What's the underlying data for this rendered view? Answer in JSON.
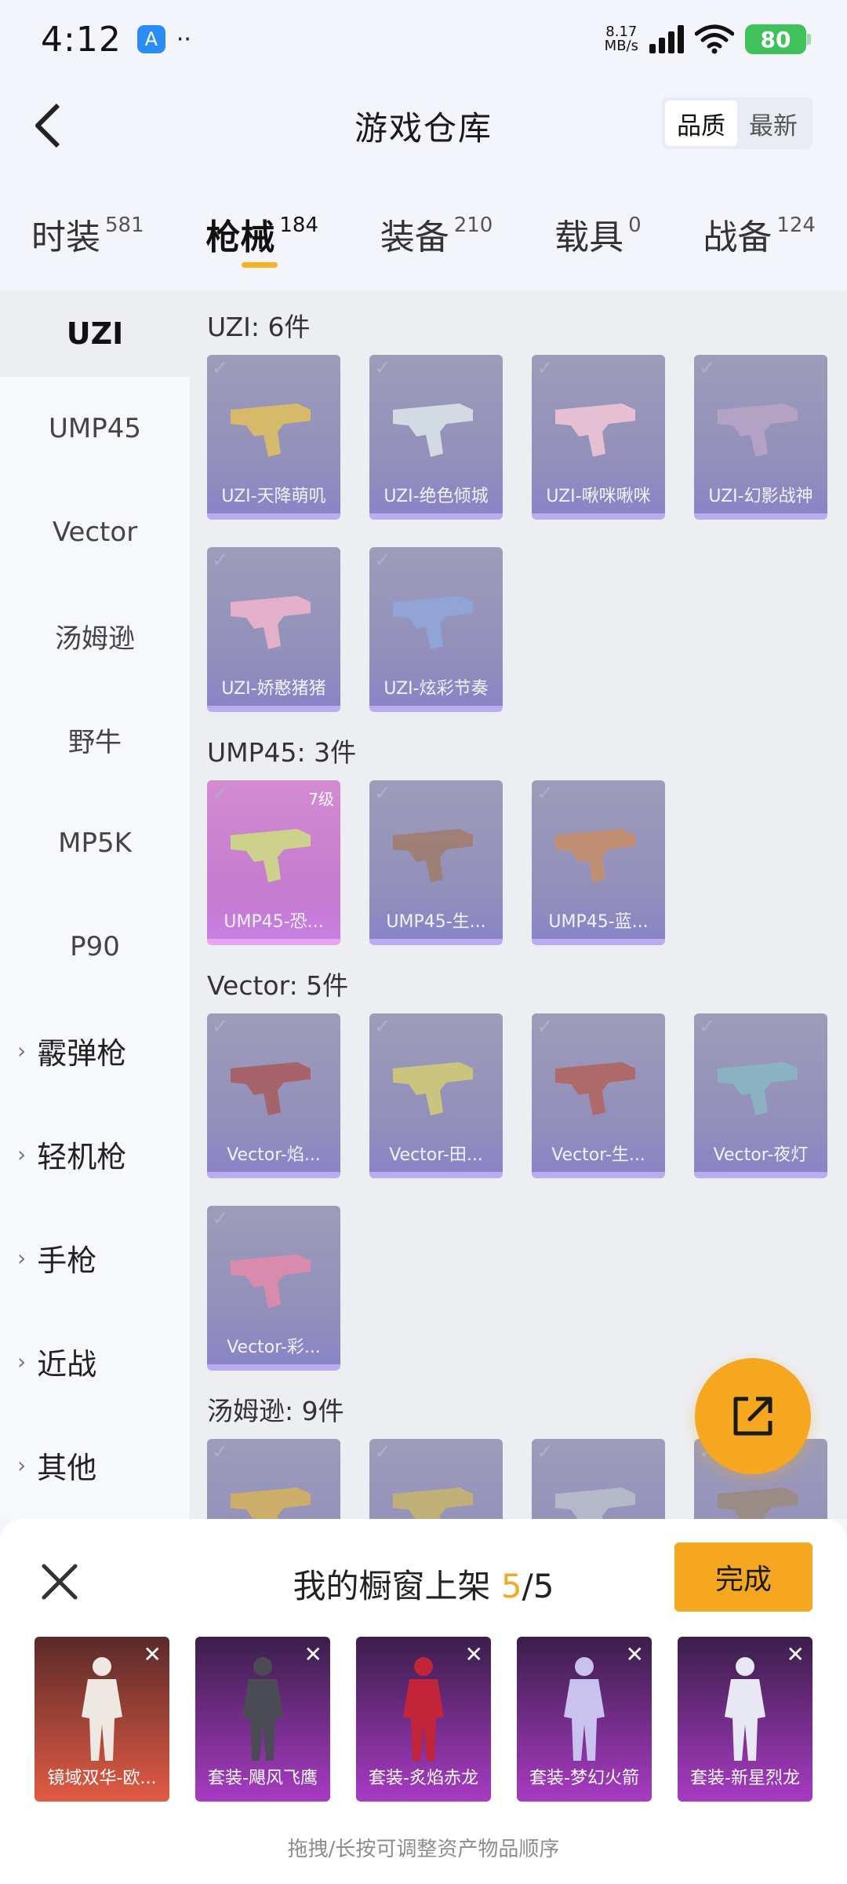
{
  "status_bar": {
    "time": "4:12",
    "dots": "··",
    "net_speed_value": "8.17",
    "net_speed_unit": "MB/s",
    "battery": "80"
  },
  "header": {
    "title": "游戏仓库",
    "sort_options": [
      "品质",
      "最新"
    ],
    "active_sort": "品质"
  },
  "tabs": [
    {
      "label": "时装",
      "count": "581"
    },
    {
      "label": "枪械",
      "count": "184"
    },
    {
      "label": "装备",
      "count": "210"
    },
    {
      "label": "载具",
      "count": "0"
    },
    {
      "label": "战备",
      "count": "124"
    }
  ],
  "active_tab": "枪械",
  "sidebar": {
    "items": [
      "UZI",
      "UMP45",
      "Vector",
      "汤姆逊",
      "野牛",
      "MP5K",
      "P90"
    ],
    "groups": [
      "霰弹枪",
      "轻机枪",
      "手枪",
      "近战",
      "其他"
    ]
  },
  "sections": [
    {
      "title": "UZI: 6件",
      "cards": [
        {
          "label": "UZI-天降萌叽",
          "color": "#e1c15a",
          "style": "normal"
        },
        {
          "label": "UZI-绝色倾城",
          "color": "#dde6ea",
          "style": "normal"
        },
        {
          "label": "UZI-啾咪啾咪",
          "color": "#f3c7d6",
          "style": "normal"
        },
        {
          "label": "UZI-幻影战神",
          "color": "#b9a5c6",
          "style": "normal"
        },
        {
          "label": "UZI-娇憨猪猪",
          "color": "#f0b5c9",
          "style": "normal"
        },
        {
          "label": "UZI-炫彩节奏",
          "color": "#8fa7dc",
          "style": "normal"
        }
      ]
    },
    {
      "title": "UMP45: 3件",
      "cards": [
        {
          "label": "UMP45-恐...",
          "color": "#cde07f",
          "style": "pink",
          "level": "7级"
        },
        {
          "label": "UMP45-生...",
          "color": "#a07b6a",
          "style": "normal"
        },
        {
          "label": "UMP45-蓝...",
          "color": "#c98e66",
          "style": "normal"
        }
      ]
    },
    {
      "title": "Vector: 5件",
      "cards": [
        {
          "label": "Vector-焰...",
          "color": "#a85c5c",
          "style": "normal"
        },
        {
          "label": "Vector-田...",
          "color": "#d2cc74",
          "style": "normal"
        },
        {
          "label": "Vector-生...",
          "color": "#b3645c",
          "style": "normal"
        },
        {
          "label": "Vector-夜灯",
          "color": "#8ab6c4",
          "style": "normal"
        },
        {
          "label": "Vector-彩...",
          "color": "#e48aa8",
          "style": "normal"
        }
      ]
    },
    {
      "title": "汤姆逊: 9件",
      "cards": [
        {
          "label": "",
          "color": "#d6b35a",
          "style": "normal"
        },
        {
          "label": "",
          "color": "#c7b56c",
          "style": "normal"
        },
        {
          "label": "",
          "color": "#b8c0cc",
          "style": "normal"
        },
        {
          "label": "",
          "color": "#9a8a7c",
          "style": "normal"
        }
      ]
    }
  ],
  "showcase": {
    "title_prefix": "我的橱窗上架 ",
    "current": "5",
    "total": "/5",
    "done_label": "完成",
    "hint": "拖拽/长按可调整资产物品顺序",
    "items": [
      {
        "label": "镜域双华-欧...",
        "bg_top": "#5a2a2a",
        "bg_bottom": "#e25b44",
        "figure": "#efe7e2"
      },
      {
        "label": "套装-飓风飞鹰",
        "bg_top": "#3b1e4a",
        "bg_bottom": "#a83bc3",
        "figure": "#4b4b55"
      },
      {
        "label": "套装-炙焰赤龙",
        "bg_top": "#3b1e4a",
        "bg_bottom": "#a83bc3",
        "figure": "#c2243a"
      },
      {
        "label": "套装-梦幻火箭",
        "bg_top": "#3b1e4a",
        "bg_bottom": "#a83bc3",
        "figure": "#c9c2ee"
      },
      {
        "label": "套装-新星烈龙",
        "bg_top": "#3b1e4a",
        "bg_bottom": "#a83bc3",
        "figure": "#e8e8f5"
      }
    ]
  }
}
